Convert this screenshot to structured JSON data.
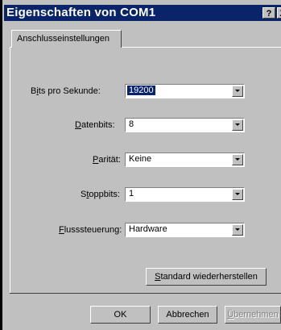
{
  "window": {
    "title": "Eigenschaften von COM1",
    "help_glyph": "?",
    "close_glyph": "X"
  },
  "tabs": [
    {
      "label": "Anschlusseinstellungen"
    }
  ],
  "fields": {
    "bits": {
      "label_pre": "B",
      "label_ul": "i",
      "label_post": "ts pro Sekunde:",
      "value": "19200"
    },
    "datenbits": {
      "label_pre": "",
      "label_ul": "D",
      "label_post": "atenbits:",
      "value": "8"
    },
    "paritaet": {
      "label_pre": "",
      "label_ul": "P",
      "label_post": "arität:",
      "value": "Keine"
    },
    "stoppbits": {
      "label_pre": "S",
      "label_ul": "t",
      "label_post": "oppbits:",
      "value": "1"
    },
    "fluss": {
      "label_pre": "",
      "label_ul": "F",
      "label_post": "lusssteuerung:",
      "value": "Hardware"
    }
  },
  "buttons": {
    "restore": {
      "ul": "S",
      "rest": "tandard wiederherstellen"
    },
    "ok": "OK",
    "cancel": "Abbrechen",
    "apply": {
      "ul": "Ü",
      "rest": "bernehmen"
    }
  }
}
